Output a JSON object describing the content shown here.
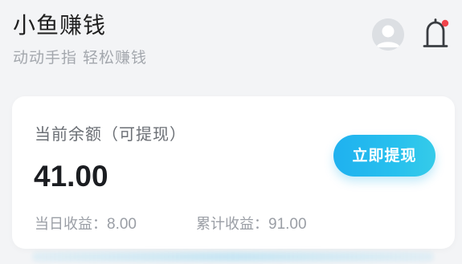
{
  "header": {
    "app_title": "小鱼赚钱",
    "app_subtitle": "动动手指 轻松赚钱",
    "avatar_icon": "user-avatar-icon",
    "bell_icon": "bell-icon",
    "notification_dot_color": "#f0444c"
  },
  "balance_card": {
    "label": "当前余额（可提现）",
    "amount": "41.00",
    "withdraw_button_label": "立即提现",
    "accent_color": "#22b6ee",
    "stats": {
      "daily_label": "当日收益：",
      "daily_value": "8.00",
      "total_label": "累计收益：",
      "total_value": "91.00"
    }
  }
}
